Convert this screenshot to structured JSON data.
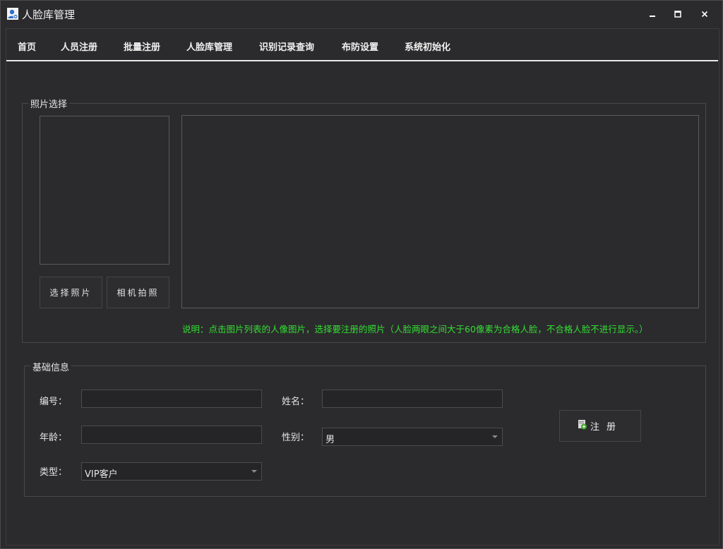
{
  "window": {
    "title": "人脸库管理"
  },
  "tabs": [
    {
      "label": "首页"
    },
    {
      "label": "人员注册"
    },
    {
      "label": "批量注册"
    },
    {
      "label": "人脸库管理"
    },
    {
      "label": "识别记录查询"
    },
    {
      "label": "布防设置"
    },
    {
      "label": "系统初始化"
    }
  ],
  "photo_section": {
    "legend": "照片选择",
    "select_photo_label": "选择照片",
    "camera_label": "相机拍照",
    "note": "说明：点击图片列表的人像图片，选择要注册的照片（人脸两眼之间大于60像素为合格人脸，不合格人脸不进行显示。）"
  },
  "info_section": {
    "legend": "基础信息",
    "id_label": "编号：",
    "id_value": "",
    "name_label": "姓名：",
    "name_value": "",
    "age_label": "年龄：",
    "age_value": "",
    "gender_label": "性别：",
    "gender_value": "男",
    "type_label": "类型：",
    "type_value": "VIP客户",
    "register_label": "注册"
  },
  "colors": {
    "background": "#2b2b2d",
    "note_text": "#33dd33",
    "tab_underline": "#e8e8e8"
  },
  "icons": {
    "app": "user-face-icon",
    "register": "add-user-icon"
  }
}
